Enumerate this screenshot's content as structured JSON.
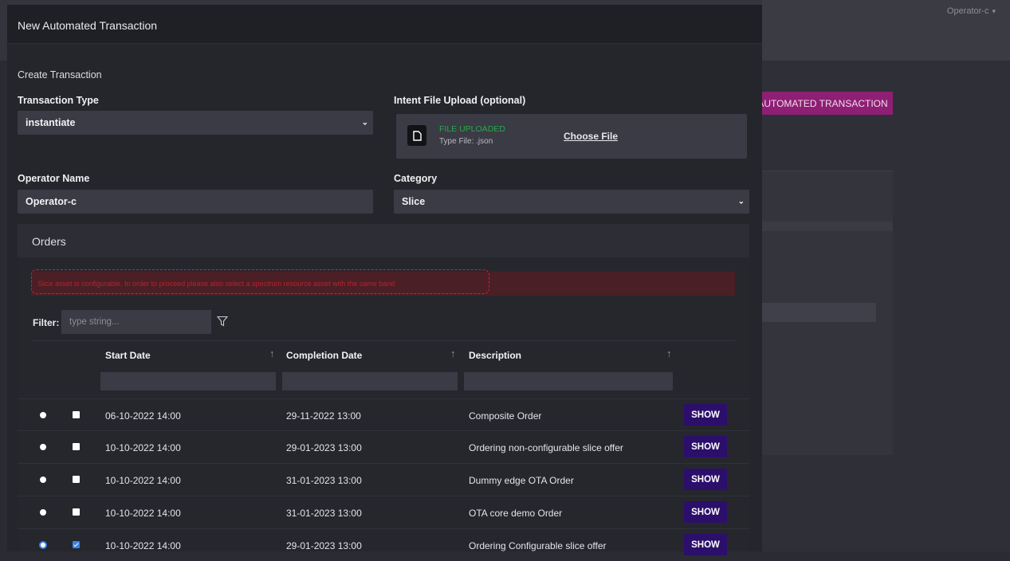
{
  "background": {
    "operator_label": "Operator-c",
    "automated_button": "AUTOMATED TRANSACTION"
  },
  "modal": {
    "title": "New Automated Transaction",
    "section": "Create Transaction",
    "transaction_type": {
      "label": "Transaction Type",
      "value": "instantiate"
    },
    "intent_upload": {
      "label": "Intent File Upload (optional)",
      "status": "FILE UPLOADED",
      "type_hint": "Type File: .json",
      "choose": "Choose File"
    },
    "operator_name": {
      "label": "Operator Name",
      "value": "Operator-c"
    },
    "category": {
      "label": "Category",
      "value": "Slice"
    }
  },
  "orders": {
    "title": "Orders",
    "error": "Slice asset is configurable. In order to proceed please also select a spectrum resource asset with the same band",
    "filter_label": "Filter:",
    "filter_placeholder": "type string...",
    "columns": {
      "start": "Start Date",
      "completion": "Completion Date",
      "description": "Description"
    },
    "rows": [
      {
        "start": "06-10-2022 14:00",
        "completion": "29-11-2022 13:00",
        "description": "Composite Order",
        "action": "SHOW"
      },
      {
        "start": "10-10-2022 14:00",
        "completion": "29-01-2023 13:00",
        "description": "Ordering non-configurable slice offer",
        "action": "SHOW"
      },
      {
        "start": "10-10-2022 14:00",
        "completion": "31-01-2023 13:00",
        "description": "Dummy edge OTA Order",
        "action": "SHOW"
      },
      {
        "start": "10-10-2022 14:00",
        "completion": "31-01-2023 13:00",
        "description": "OTA core demo Order",
        "action": "SHOW"
      },
      {
        "start": "10-10-2022 14:00",
        "completion": "29-01-2023 13:00",
        "description": "Ordering Configurable slice offer",
        "action": "SHOW"
      }
    ]
  },
  "colors": {
    "accent": "#3b83e6",
    "error": "#d22030",
    "show_button": "#2b0f6b",
    "brand": "#8e1f74",
    "success": "#2aa84a"
  }
}
